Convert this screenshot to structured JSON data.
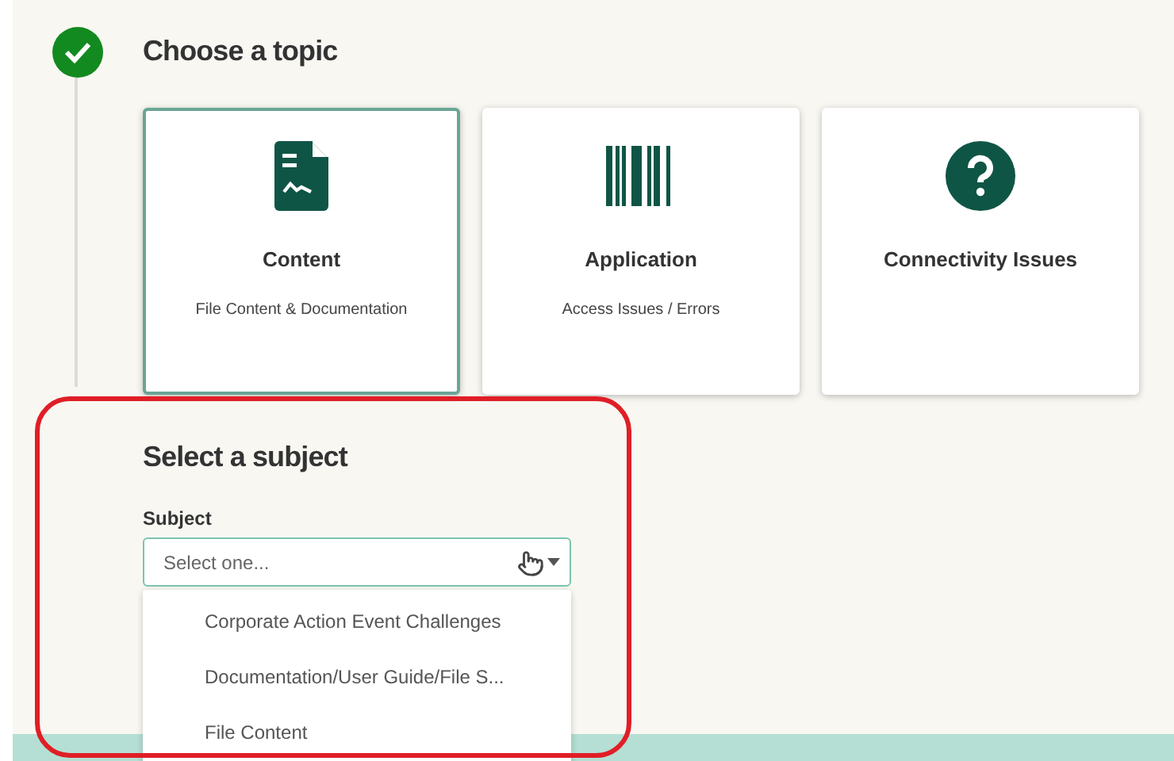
{
  "step": {
    "complete": true,
    "title": "Choose a topic"
  },
  "topics": [
    {
      "title": "Content",
      "subtitle": "File Content & Documentation",
      "kind": "document",
      "selected": true
    },
    {
      "title": "Application",
      "subtitle": "Access Issues / Errors",
      "kind": "barcode",
      "selected": false
    },
    {
      "title": "Connectivity Issues",
      "kind": "question",
      "selected": false
    }
  ],
  "subject_section": {
    "title": "Select a subject",
    "label": "Subject",
    "placeholder": "Select one...",
    "expanded": true,
    "options": [
      "Corporate Action Event Challenges",
      "Documentation/User Guide/File S...",
      "File Content"
    ]
  }
}
